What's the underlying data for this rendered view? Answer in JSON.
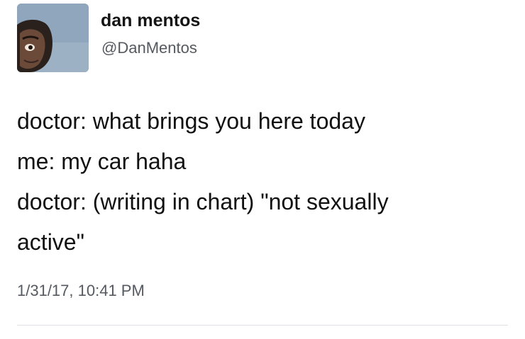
{
  "tweet": {
    "author": {
      "display_name": "dan mentos",
      "handle": "@DanMentos",
      "avatar_icon": "profile-photo"
    },
    "text_lines": [
      "doctor: what brings you here today",
      "me: my car haha",
      "doctor: (writing in chart) \"not sexually",
      "active\""
    ],
    "timestamp": "1/31/17, 10:41 PM"
  },
  "colors": {
    "name_text": "#141414",
    "secondary_text": "#555a60",
    "body_text": "#111111",
    "avatar_background": "#8fa6bd",
    "divider": "#dcdfe3"
  }
}
